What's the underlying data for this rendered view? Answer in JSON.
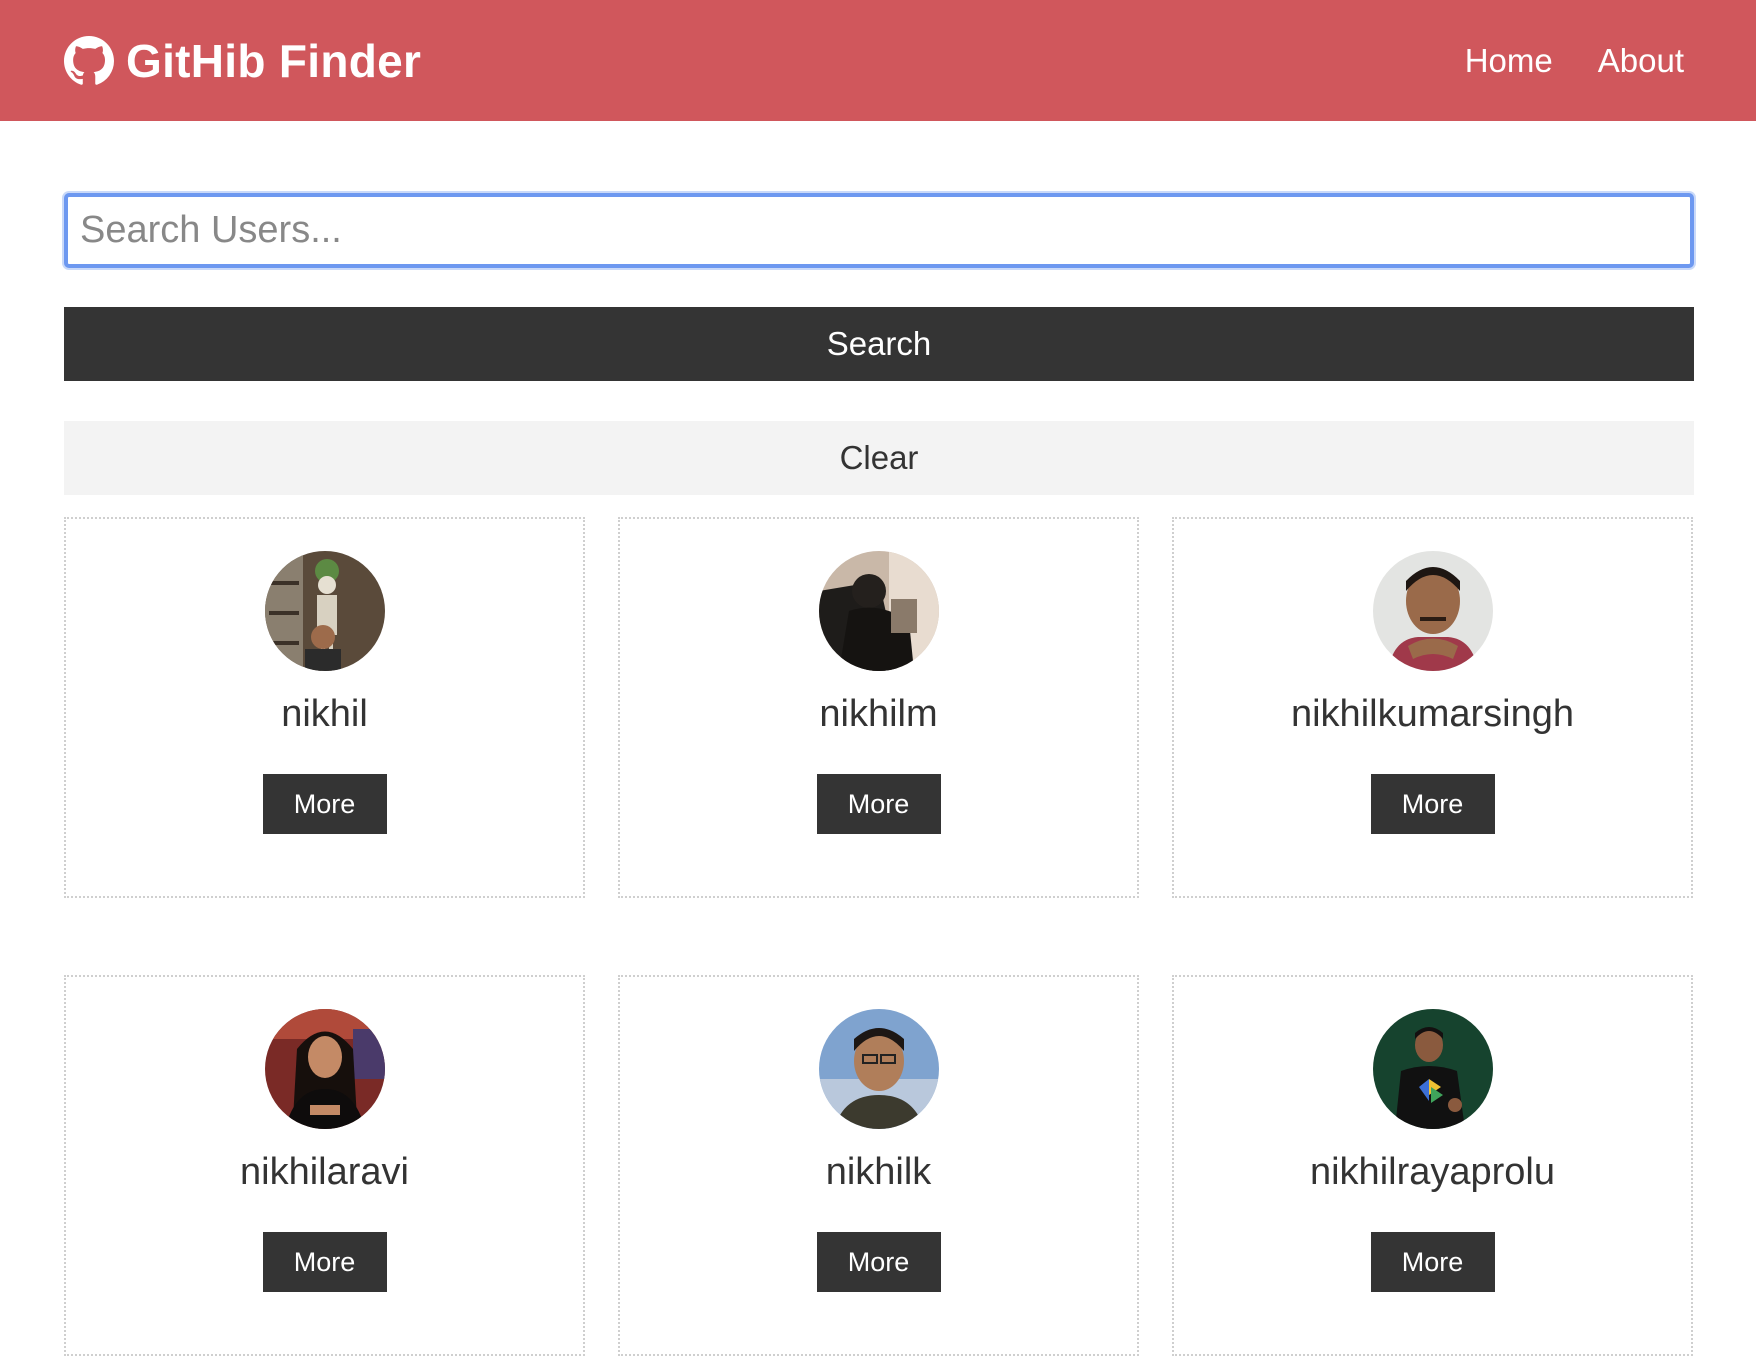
{
  "navbar": {
    "brand_icon": "github-icon",
    "title": "GitHib Finder",
    "links": [
      "Home",
      "About"
    ],
    "color": "#d0575c"
  },
  "search": {
    "placeholder": "Search Users...",
    "value": "",
    "search_label": "Search",
    "clear_label": "Clear"
  },
  "users": [
    {
      "login": "nikhil",
      "more_label": "More",
      "avatar": "user-avatar-photo"
    },
    {
      "login": "nikhilm",
      "more_label": "More",
      "avatar": "user-avatar-photo"
    },
    {
      "login": "nikhilkumarsingh",
      "more_label": "More",
      "avatar": "user-avatar-photo"
    },
    {
      "login": "nikhilaravi",
      "more_label": "More",
      "avatar": "user-avatar-photo"
    },
    {
      "login": "nikhilk",
      "more_label": "More",
      "avatar": "user-avatar-photo"
    },
    {
      "login": "nikhilrayaprolu",
      "more_label": "More",
      "avatar": "user-avatar-photo"
    }
  ]
}
